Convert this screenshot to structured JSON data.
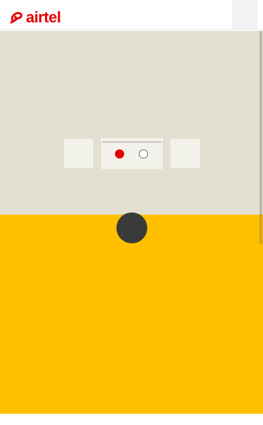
{
  "header": {
    "brand_name": "airtel",
    "brand_color": "#e40000",
    "logo_icon": "airtel-swirl-icon",
    "menu_icon": "menu-icon"
  },
  "carousel": {
    "background": "#e3e0d1",
    "slide_count": 2,
    "active_slide": 1,
    "indicator_active_color": "#e40000"
  },
  "content": {
    "section_color": "#ffc000",
    "scroll_handle_icon": "scroll-indicator-icon"
  }
}
